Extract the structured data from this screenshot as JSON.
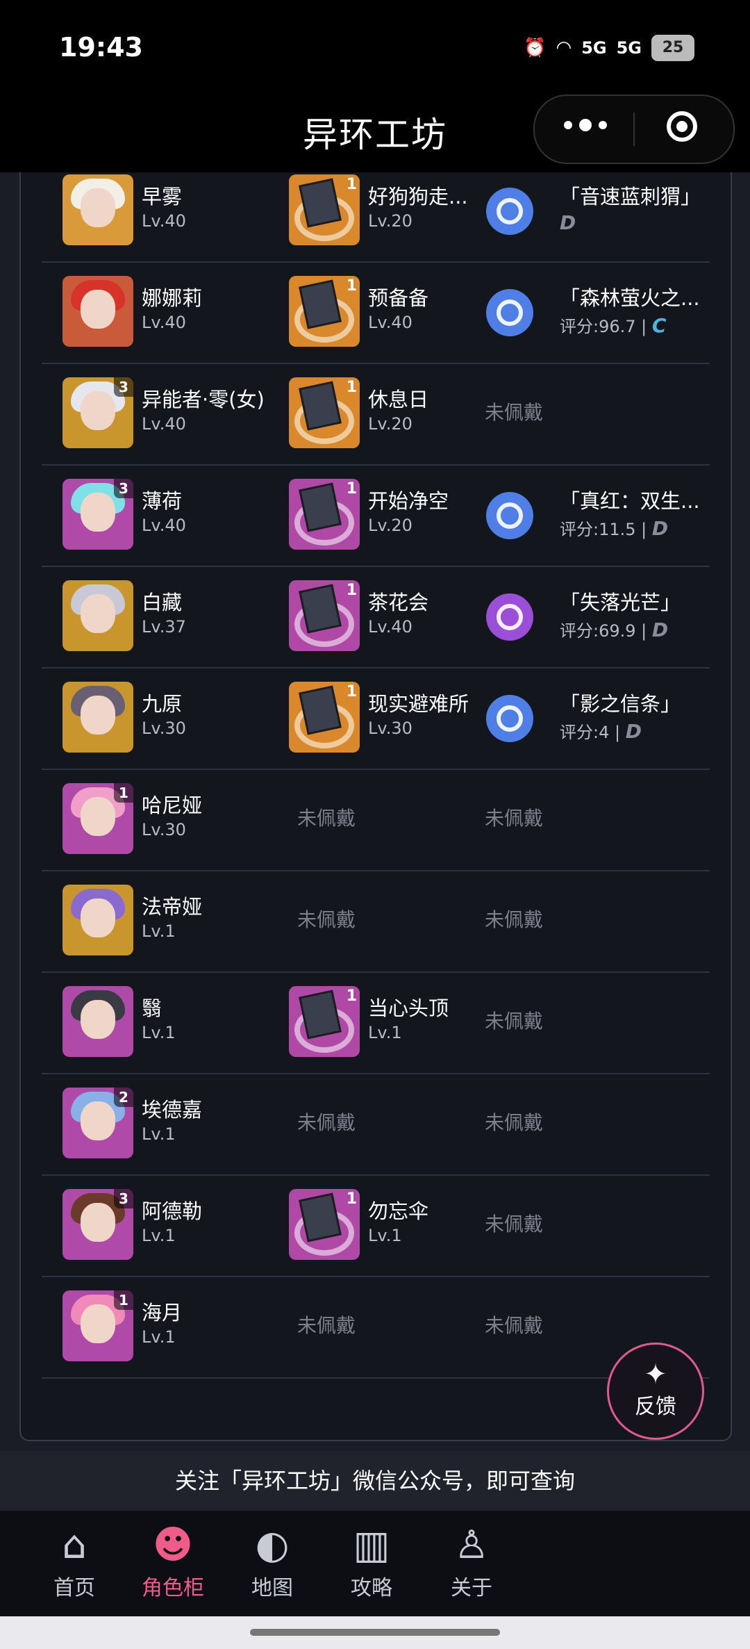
{
  "status_bar": {
    "time": "19:43",
    "signal1": "5G",
    "signal2": "5G",
    "battery": "25"
  },
  "header": {
    "title": "异环工坊"
  },
  "rows": [
    {
      "name": "早雾",
      "level": "Lv.40",
      "rank": "",
      "avatar_color": "#d99a3a",
      "hair_color": "#f2efe6",
      "engine": {
        "name": "好狗狗走...",
        "level": "Lv.20",
        "rank": "1",
        "bg": "#d9892b"
      },
      "badge": {
        "name": "「音速蓝刺猬」",
        "score": "",
        "grade": "D",
        "grade_color": "#8a8d99",
        "color": "#4f7fe6"
      }
    },
    {
      "name": "娜娜莉",
      "level": "Lv.40",
      "rank": "",
      "avatar_color": "#c95a3a",
      "hair_color": "#d8332a",
      "engine": {
        "name": "预备备",
        "level": "Lv.40",
        "rank": "1",
        "bg": "#d9892b"
      },
      "badge": {
        "name": "「森林萤火之...",
        "score": "评分:96.7 |",
        "grade": "C",
        "grade_color": "#4fb3e0",
        "color": "#4f7fe6"
      }
    },
    {
      "name": "异能者·零(女)",
      "level": "Lv.40",
      "rank": "3",
      "avatar_color": "#c9962e",
      "hair_color": "#e6e6ee",
      "engine": {
        "name": "休息日",
        "level": "Lv.20",
        "rank": "1",
        "bg": "#d9892b"
      },
      "badge": null
    },
    {
      "name": "薄荷",
      "level": "Lv.40",
      "rank": "3",
      "avatar_color": "#b04aa8",
      "hair_color": "#7fe0e8",
      "engine": {
        "name": "开始净空",
        "level": "Lv.20",
        "rank": "1",
        "bg": "#b048a6"
      },
      "badge": {
        "name": "「真红：双生...",
        "score": "评分:11.5 |",
        "grade": "D",
        "grade_color": "#8a8d99",
        "color": "#4f7fe6"
      }
    },
    {
      "name": "白藏",
      "level": "Lv.37",
      "rank": "",
      "avatar_color": "#c9962e",
      "hair_color": "#c8c8d6",
      "engine": {
        "name": "茶花会",
        "level": "Lv.40",
        "rank": "1",
        "bg": "#b048a6"
      },
      "badge": {
        "name": "「失落光芒」",
        "score": "评分:69.9 |",
        "grade": "D",
        "grade_color": "#8a8d99",
        "color": "#9b4fd8"
      }
    },
    {
      "name": "九原",
      "level": "Lv.30",
      "rank": "",
      "avatar_color": "#c9962e",
      "hair_color": "#6a5e72",
      "engine": {
        "name": "现实避难所",
        "level": "Lv.30",
        "rank": "1",
        "bg": "#d9892b"
      },
      "badge": {
        "name": "「影之信条」",
        "score": "评分:4 |",
        "grade": "D",
        "grade_color": "#8a8d99",
        "color": "#4f7fe6"
      }
    },
    {
      "name": "哈尼娅",
      "level": "Lv.30",
      "rank": "1",
      "avatar_color": "#b04aa8",
      "hair_color": "#f0a0c8",
      "engine": null,
      "badge": null
    },
    {
      "name": "法帝娅",
      "level": "Lv.1",
      "rank": "",
      "avatar_color": "#c9962e",
      "hair_color": "#8a6ad0",
      "engine": null,
      "badge": null
    },
    {
      "name": "翳",
      "level": "Lv.1",
      "rank": "",
      "avatar_color": "#b04aa8",
      "hair_color": "#3a3a44",
      "engine": {
        "name": "当心头顶",
        "level": "Lv.1",
        "rank": "1",
        "bg": "#b048a6"
      },
      "badge": null
    },
    {
      "name": "埃德嘉",
      "level": "Lv.1",
      "rank": "2",
      "avatar_color": "#b04aa8",
      "hair_color": "#8ab0e8",
      "engine": null,
      "badge": null
    },
    {
      "name": "阿德勒",
      "level": "Lv.1",
      "rank": "3",
      "avatar_color": "#b04aa8",
      "hair_color": "#6a3a2a",
      "engine": {
        "name": "勿忘伞",
        "level": "Lv.1",
        "rank": "1",
        "bg": "#b048a6"
      },
      "badge": null
    },
    {
      "name": "海月",
      "level": "Lv.1",
      "rank": "1",
      "avatar_color": "#b04aa8",
      "hair_color": "#f08ab8",
      "engine": null,
      "badge": null
    }
  ],
  "not_equipped": "未佩戴",
  "feedback": {
    "label": "反馈"
  },
  "banner": "关注「异环工坊」微信公众号，即可查询",
  "tabs": [
    {
      "label": "首页",
      "icon": "home-icon",
      "glyph": "⌂",
      "active": false
    },
    {
      "label": "角色柜",
      "icon": "character-icon",
      "glyph": "☻",
      "active": true
    },
    {
      "label": "地图",
      "icon": "globe-icon",
      "glyph": "◐",
      "active": false
    },
    {
      "label": "攻略",
      "icon": "book-icon",
      "glyph": "▥",
      "active": false
    },
    {
      "label": "关于",
      "icon": "user-search-icon",
      "glyph": "♙",
      "active": false
    }
  ],
  "colors": {
    "accent": "#f05b8a",
    "background": "#14161e"
  }
}
